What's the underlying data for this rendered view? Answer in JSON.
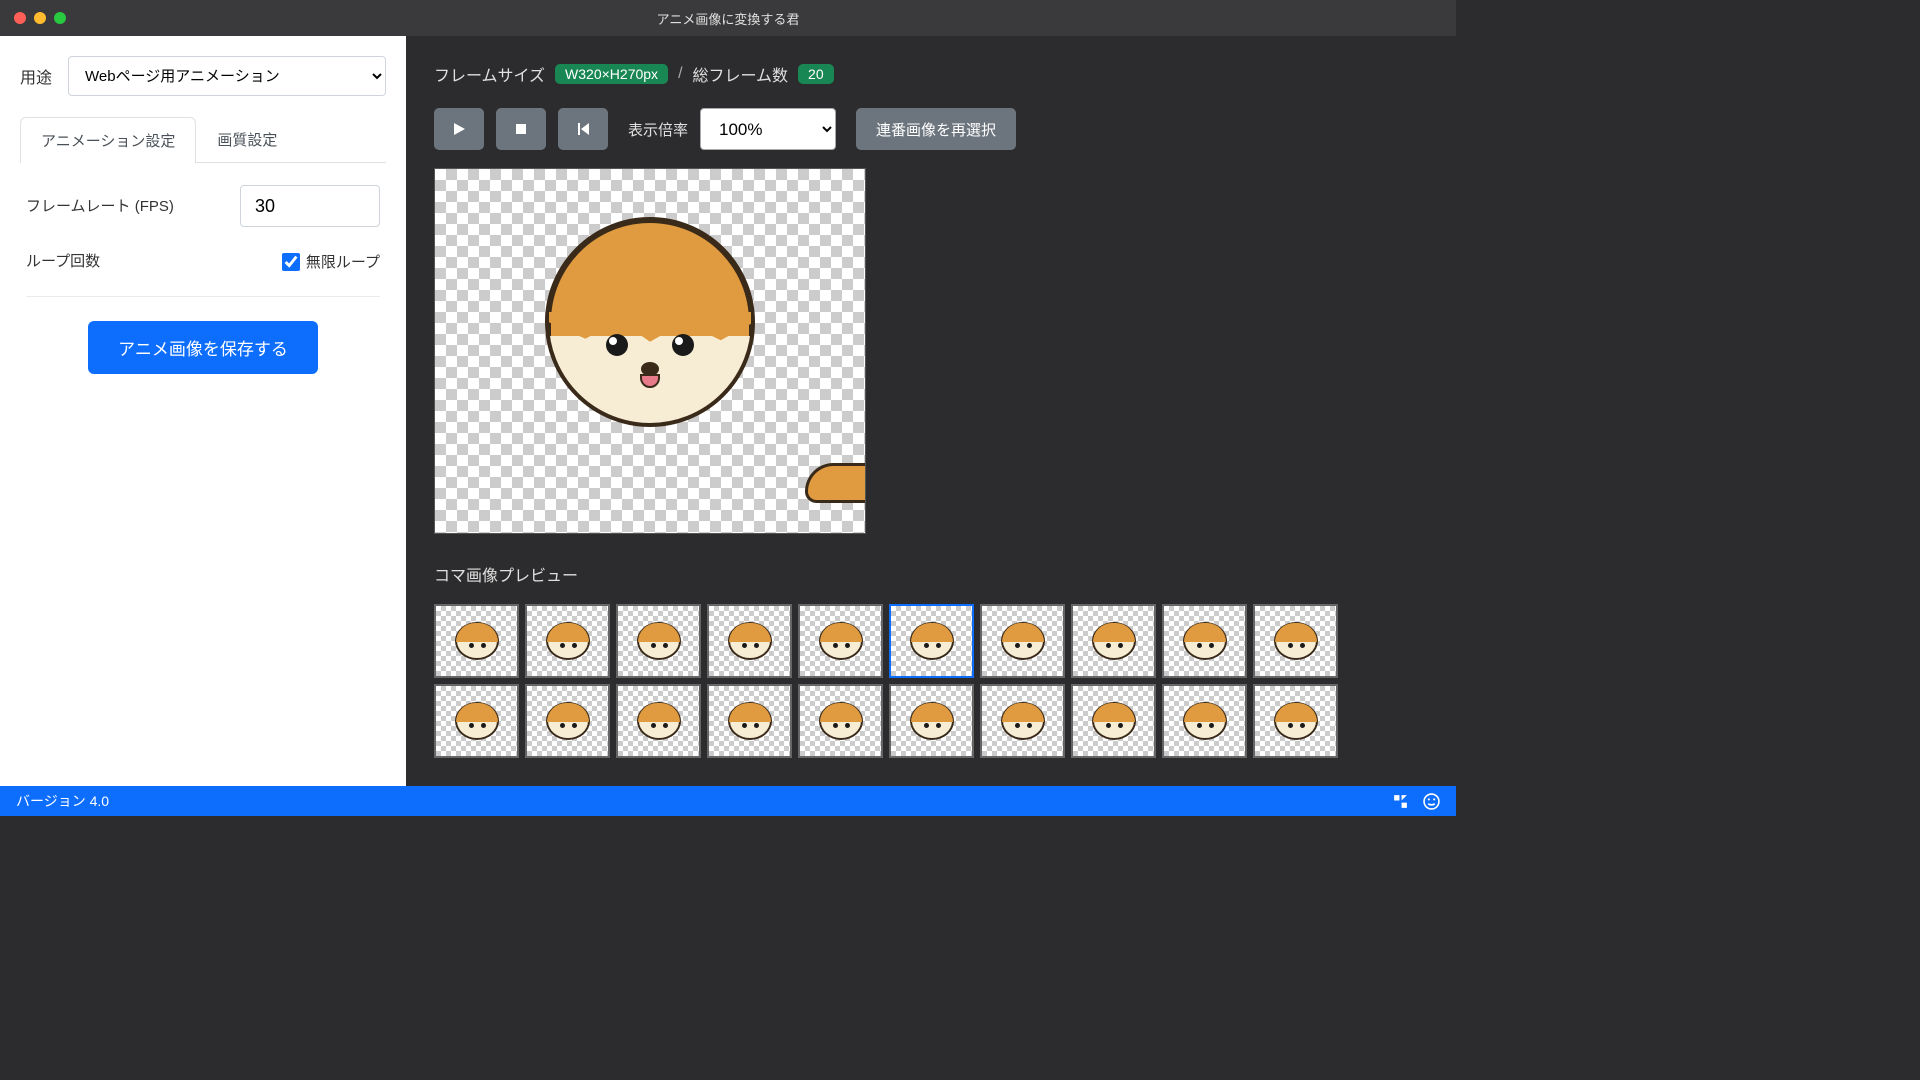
{
  "window": {
    "title": "アニメ画像に変換する君"
  },
  "sidebar": {
    "purpose_label": "用途",
    "purpose_value": "Webページ用アニメーション",
    "tabs": {
      "anim": "アニメーション設定",
      "quality": "画質設定"
    },
    "fps_label": "フレームレート (FPS)",
    "fps_value": "30",
    "loop_label": "ループ回数",
    "loop_infinite": "無限ループ",
    "loop_checked": true,
    "save_btn": "アニメ画像を保存する"
  },
  "info": {
    "frame_size_label": "フレームサイズ",
    "frame_size_value": "W320×H270px",
    "separator": "/",
    "total_frames_label": "総フレーム数",
    "total_frames_value": "20"
  },
  "controls": {
    "zoom_label": "表示倍率",
    "zoom_value": "100%",
    "reselect": "連番画像を再選択"
  },
  "thumbs": {
    "title": "コマ画像プレビュー",
    "count": 20,
    "selected_index": 5
  },
  "status": {
    "version": "バージョン 4.0"
  }
}
